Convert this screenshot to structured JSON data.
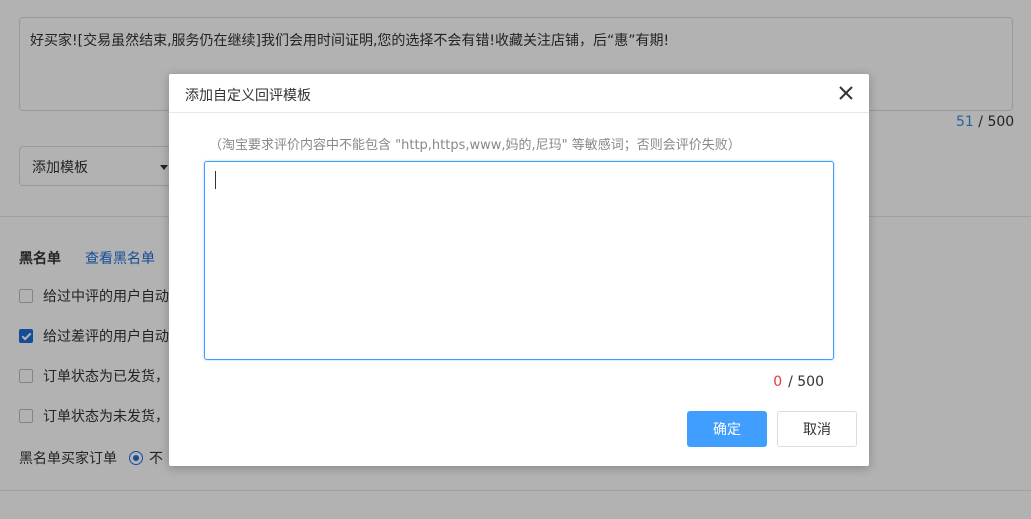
{
  "background": {
    "reply_text": "好买家![交易虽然结束,服务仍在继续]我们会用时间证明,您的选择不会有错!收藏关注店铺，后“惠”有期!",
    "counter_current": "51",
    "counter_sep": " / 500",
    "template_select": "添加模板",
    "blacklist_title": "黑名单",
    "blacklist_link": "查看黑名单",
    "options": [
      {
        "label": "给过中评的用户自动",
        "checked": false
      },
      {
        "label": "给过差评的用户自动",
        "checked": true
      },
      {
        "label": "订单状态为已发货，",
        "checked": false
      },
      {
        "label": "订单状态为未发货，",
        "checked": false
      }
    ],
    "radio_label": "黑名单买家订单",
    "radio_option": "不"
  },
  "modal": {
    "title": "添加自定义回评模板",
    "hint": "（淘宝要求评价内容中不能包含 \"http,https,www,妈的,尼玛\" 等敏感词；否则会评价失败）",
    "input_value": "",
    "counter_current": "0",
    "counter_max": "/ 500",
    "ok_label": "确定",
    "cancel_label": "取消"
  },
  "colors": {
    "accent": "#409eff",
    "link": "#1e6fd9",
    "error": "#e4393c"
  }
}
